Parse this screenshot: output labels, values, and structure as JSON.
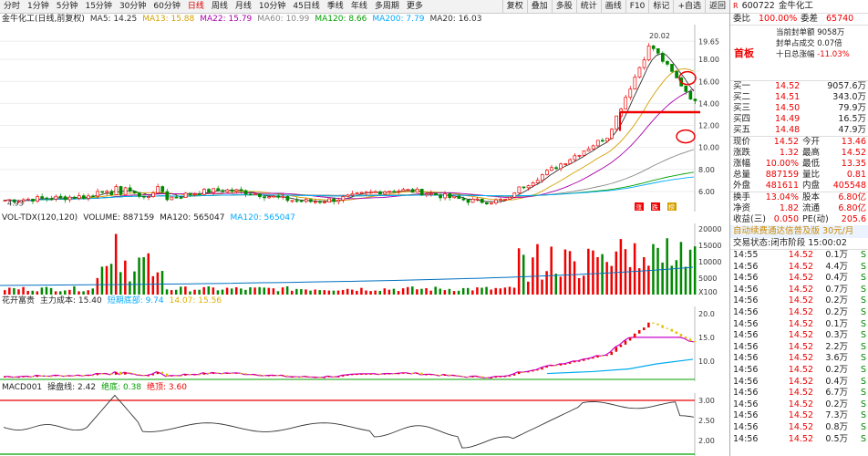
{
  "toolbar": {
    "tabs": [
      "分时",
      "1分钟",
      "5分钟",
      "15分钟",
      "30分钟",
      "60分钟",
      "日线",
      "周线",
      "月线",
      "10分钟",
      "45日线",
      "季线",
      "年线",
      "多周期",
      "更多"
    ],
    "active_tab": "日线",
    "right_buttons": [
      "复权",
      "叠加",
      "多股",
      "统计",
      "画线",
      "F10",
      "标记",
      "+自选",
      "返回"
    ]
  },
  "main_legend": {
    "stock": "金牛化工(日线,前复权)",
    "ma5": "MA5: 14.25",
    "ma13": "MA13: 15.88",
    "ma22": "MA22: 15.79",
    "ma60": "MA60: 10.99",
    "ma120": "MA120: 8.66",
    "ma200": "MA200: 7.79",
    "ma20": "MA20: 16.03"
  },
  "main_axis": [
    "19.65",
    "18.00",
    "16.00",
    "14.00",
    "12.00",
    "10.00",
    "8.00",
    "6.00"
  ],
  "peak_label": "20.02",
  "low_label": "4.93",
  "event_tags": [
    "涨",
    "跌",
    "榜"
  ],
  "vol_legend": {
    "name": "VOL-TDX(120,120)",
    "volume": "VOLUME: 887159",
    "ma120a": "MA120: 565047",
    "ma120b": "MA120: 565047"
  },
  "vol_axis": [
    "20000",
    "15000",
    "10000",
    "5000",
    "X100"
  ],
  "cost_legend": {
    "name": "花开富贵",
    "main": "主力成本: 15.40",
    "bottom": "短期底部: 9.74",
    "top": "14.07: 15.56"
  },
  "cost_axis": [
    "20.0",
    "15.0",
    "10.0"
  ],
  "macd_legend": {
    "name": "MACD001",
    "op": "操盘线: 2.42",
    "ceil": "绝底: 0.38",
    "top": "绝顶: 3.60"
  },
  "macd_axis": [
    "3.00",
    "2.50",
    "2.00"
  ],
  "quote": {
    "code": "600722",
    "name": "金牛化工",
    "wei_bi_label": "委比",
    "wei_bi": "100.00%",
    "wei_cha_label": "委差",
    "wei_cha": "65740",
    "tag": "首板",
    "info": [
      "当前封单额",
      "9058万",
      "封单占成交",
      "0.07倍",
      "十日总涨幅",
      "-11.03%"
    ],
    "sells": [],
    "buys": [
      {
        "label": "买一",
        "price": "14.52",
        "vol": "9057.6万"
      },
      {
        "label": "买二",
        "price": "14.51",
        "vol": "343.0万"
      },
      {
        "label": "买三",
        "price": "14.50",
        "vol": "79.9万"
      },
      {
        "label": "买四",
        "price": "14.49",
        "vol": "16.5万"
      },
      {
        "label": "买五",
        "price": "14.48",
        "vol": "47.9万"
      }
    ],
    "stats": [
      {
        "l1": "现价",
        "v1": "14.52",
        "l2": "今开",
        "v2": "13.46"
      },
      {
        "l1": "涨跌",
        "v1": "1.32",
        "l2": "最高",
        "v2": "14.52"
      },
      {
        "l1": "涨幅",
        "v1": "10.00%",
        "l2": "最低",
        "v2": "13.35"
      },
      {
        "l1": "总量",
        "v1": "887159",
        "l2": "量比",
        "v2": "0.81"
      },
      {
        "l1": "外盘",
        "v1": "481611",
        "l2": "内盘",
        "v2": "405548"
      }
    ],
    "stats2": [
      {
        "l1": "换手",
        "v1": "13.04%",
        "l2": "股本",
        "v2": "6.80亿"
      },
      {
        "l1": "净资",
        "v1": "1.82",
        "l2": "流通",
        "v2": "6.80亿"
      },
      {
        "l1": "收益(三)",
        "v1": "0.050",
        "l2": "PE(动)",
        "v2": "205.6"
      }
    ],
    "banner": "自动续费通达信普及版 30元/月",
    "trade_status_label": "交易状态:",
    "trade_status": "闭市阶段 15:00:02",
    "ticks": [
      {
        "t": "14:55",
        "p": "14.52",
        "v": "0.1万",
        "s": "S"
      },
      {
        "t": "14:56",
        "p": "14.52",
        "v": "4.4万",
        "s": "S"
      },
      {
        "t": "14:56",
        "p": "14.52",
        "v": "0.4万",
        "s": "S"
      },
      {
        "t": "14:56",
        "p": "14.52",
        "v": "0.7万",
        "s": "S"
      },
      {
        "t": "14:56",
        "p": "14.52",
        "v": "0.2万",
        "s": "S"
      },
      {
        "t": "14:56",
        "p": "14.52",
        "v": "0.2万",
        "s": "S"
      },
      {
        "t": "14:56",
        "p": "14.52",
        "v": "0.1万",
        "s": "S"
      },
      {
        "t": "14:56",
        "p": "14.52",
        "v": "0.3万",
        "s": "S"
      },
      {
        "t": "14:56",
        "p": "14.52",
        "v": "2.2万",
        "s": "S"
      },
      {
        "t": "14:56",
        "p": "14.52",
        "v": "3.6万",
        "s": "S"
      },
      {
        "t": "14:56",
        "p": "14.52",
        "v": "0.2万",
        "s": "S"
      },
      {
        "t": "14:56",
        "p": "14.52",
        "v": "0.4万",
        "s": "S"
      },
      {
        "t": "14:56",
        "p": "14.52",
        "v": "6.7万",
        "s": "S"
      },
      {
        "t": "14:56",
        "p": "14.52",
        "v": "0.2万",
        "s": "S"
      },
      {
        "t": "14:56",
        "p": "14.52",
        "v": "7.3万",
        "s": "S"
      },
      {
        "t": "14:56",
        "p": "14.52",
        "v": "0.8万",
        "s": "S"
      },
      {
        "t": "14:56",
        "p": "14.52",
        "v": "0.5万",
        "s": "S"
      }
    ]
  },
  "colors": {
    "up": "#e00000",
    "down": "#008800",
    "ma_white": "#333333",
    "ma_yellow": "#d4a000",
    "ma_purple": "#aa00aa",
    "ma_green": "#00a000",
    "ma_blue": "#00aaff"
  }
}
